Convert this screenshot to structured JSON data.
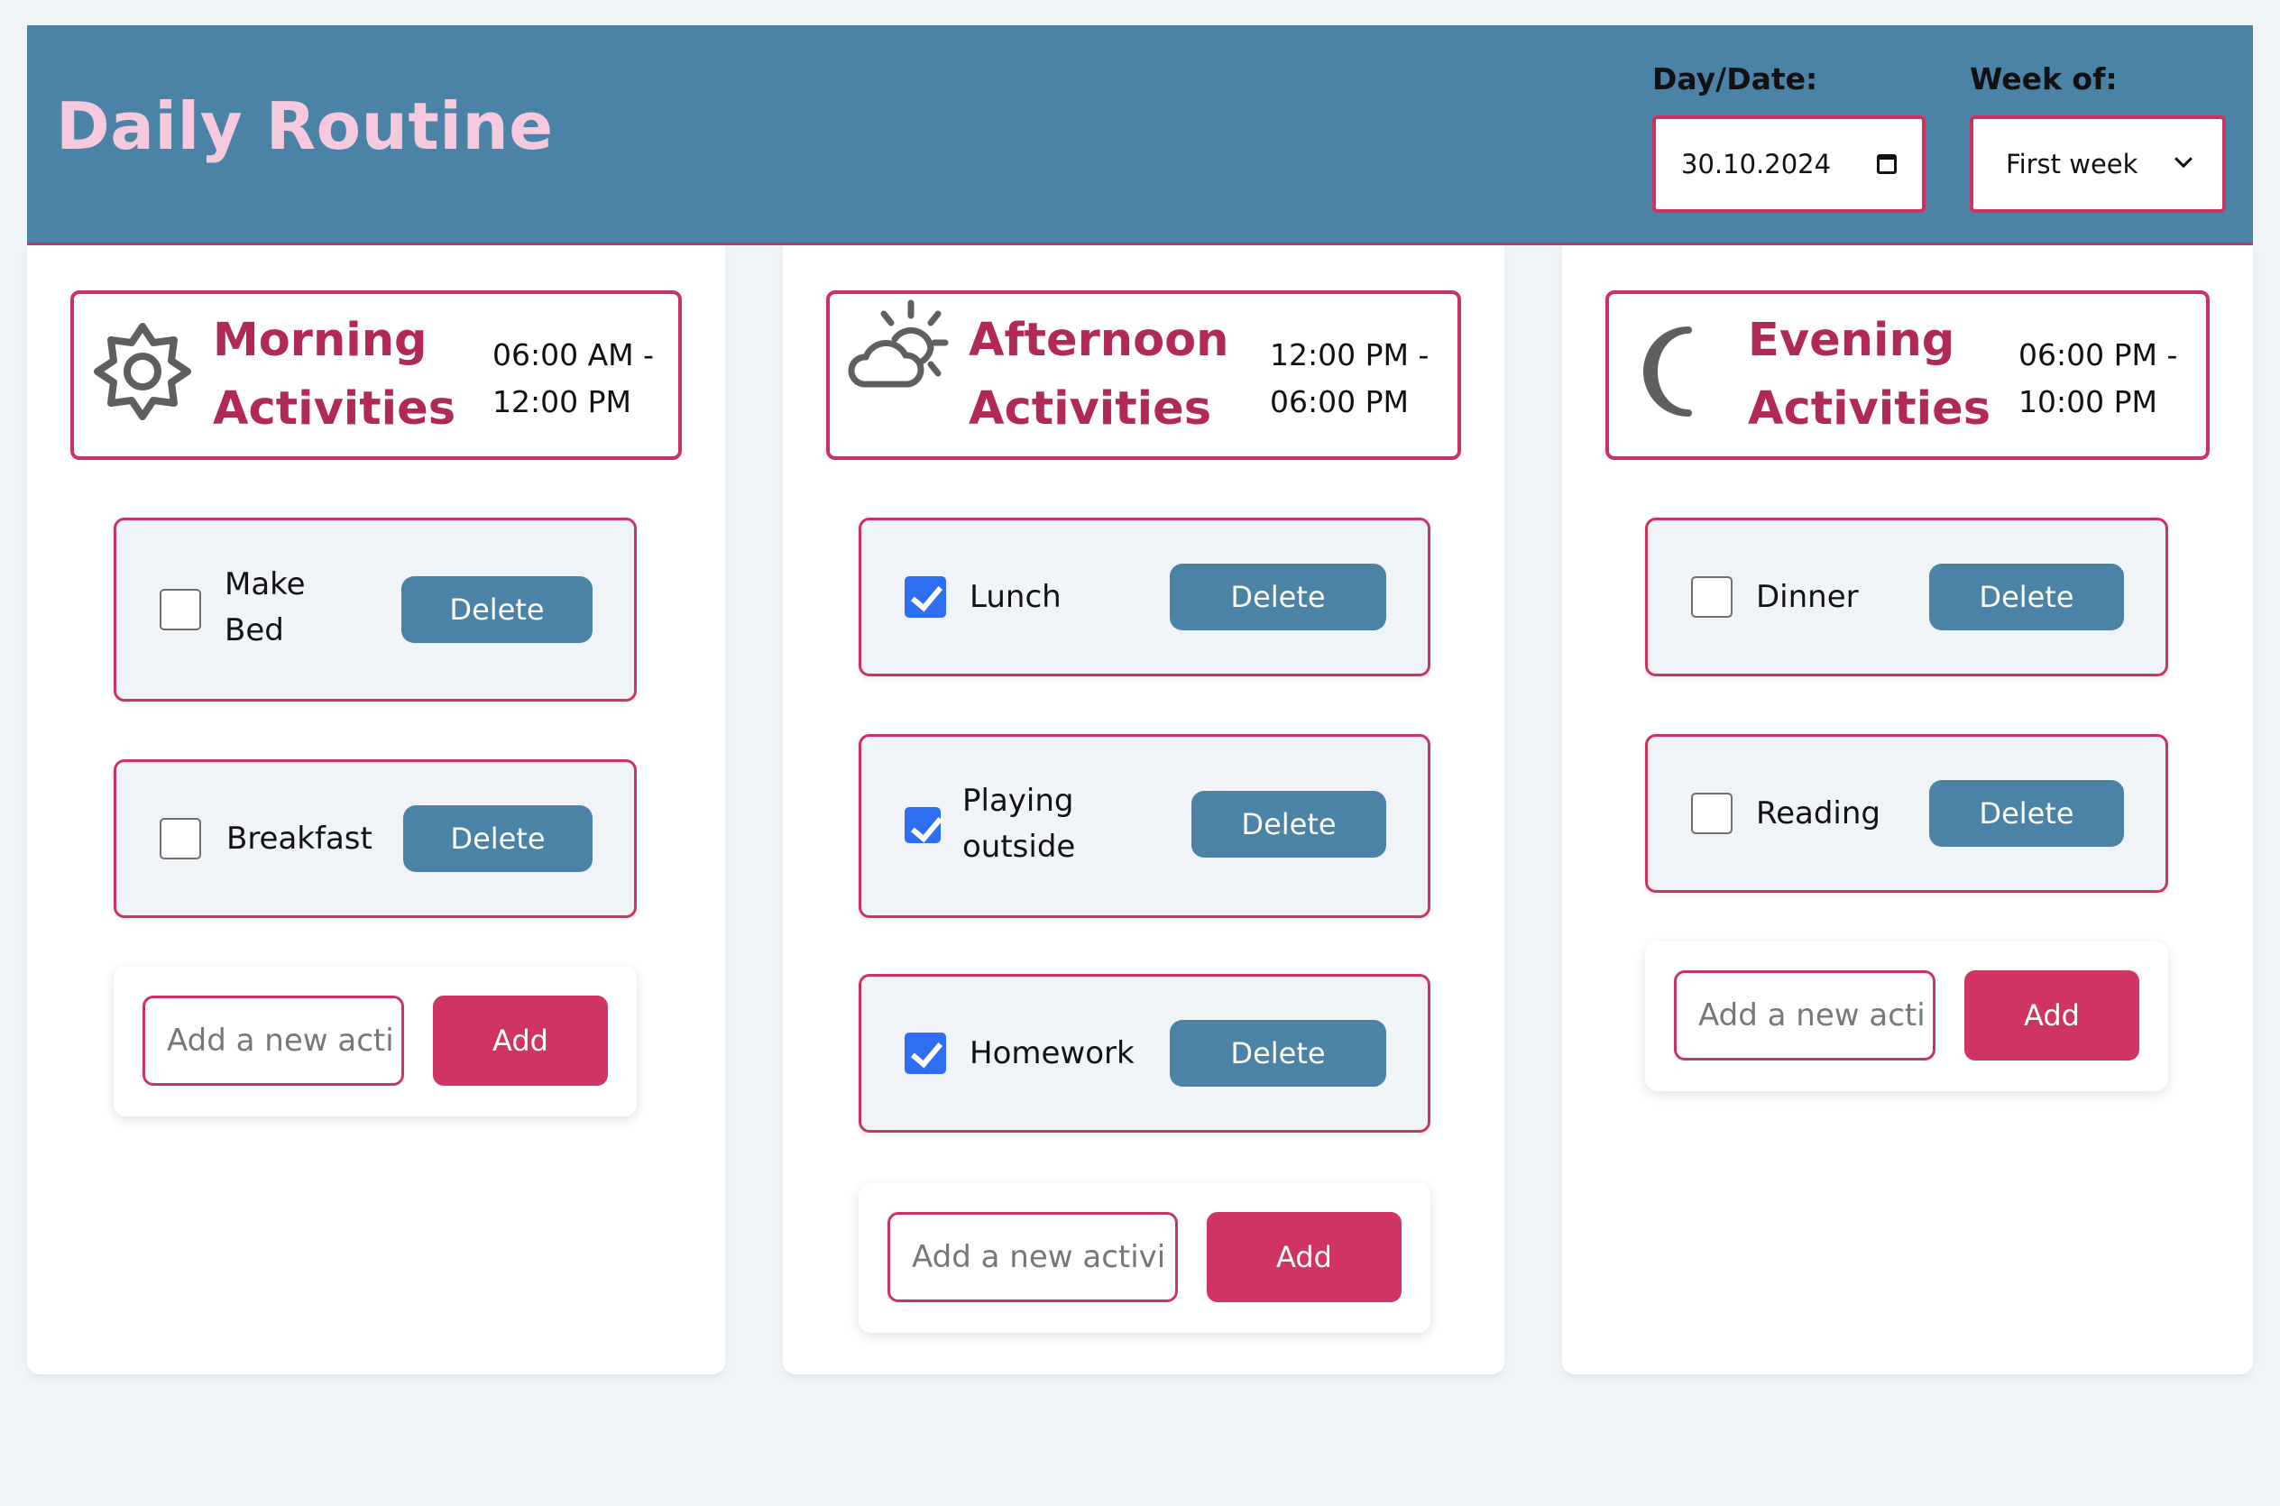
{
  "header": {
    "title": "Daily Routine",
    "date_label": "Day/Date:",
    "date_value": "30.10.2024",
    "week_label": "Week of:",
    "week_value": "First week"
  },
  "sections": [
    {
      "title": "Morning\nActivities",
      "time": "06:00 AM -\n12:00 PM",
      "icon": "sun-gear-icon",
      "tasks": [
        {
          "label": "Make\nBed",
          "checked": false,
          "delete_label": "Delete"
        },
        {
          "label": "Breakfast",
          "checked": false,
          "delete_label": "Delete"
        }
      ],
      "add_placeholder": "Add a new acti",
      "add_label": "Add"
    },
    {
      "title": "Afternoon\nActivities",
      "time": "12:00 PM -\n06:00 PM",
      "icon": "cloud-sun-icon",
      "tasks": [
        {
          "label": "Lunch",
          "checked": true,
          "delete_label": "Delete"
        },
        {
          "label": "Playing\noutside",
          "checked": true,
          "delete_label": "Delete"
        },
        {
          "label": "Homework",
          "checked": true,
          "delete_label": "Delete"
        }
      ],
      "add_placeholder": "Add a new activi",
      "add_label": "Add"
    },
    {
      "title": "Evening\nActivities",
      "time": "06:00 PM -\n10:00 PM",
      "icon": "moon-icon",
      "tasks": [
        {
          "label": "Dinner",
          "checked": false,
          "delete_label": "Delete"
        },
        {
          "label": "Reading",
          "checked": false,
          "delete_label": "Delete"
        }
      ],
      "add_placeholder": "Add a new acti",
      "add_label": "Add"
    }
  ],
  "colors": {
    "header_bg": "#4a83a5",
    "title_pink": "#f6c9dc",
    "accent": "#cc3360",
    "section_title": "#b12a55",
    "delete_bg": "#4a83a5",
    "add_bg": "#cf3462",
    "checkbox_checked": "#2f6ef3"
  }
}
